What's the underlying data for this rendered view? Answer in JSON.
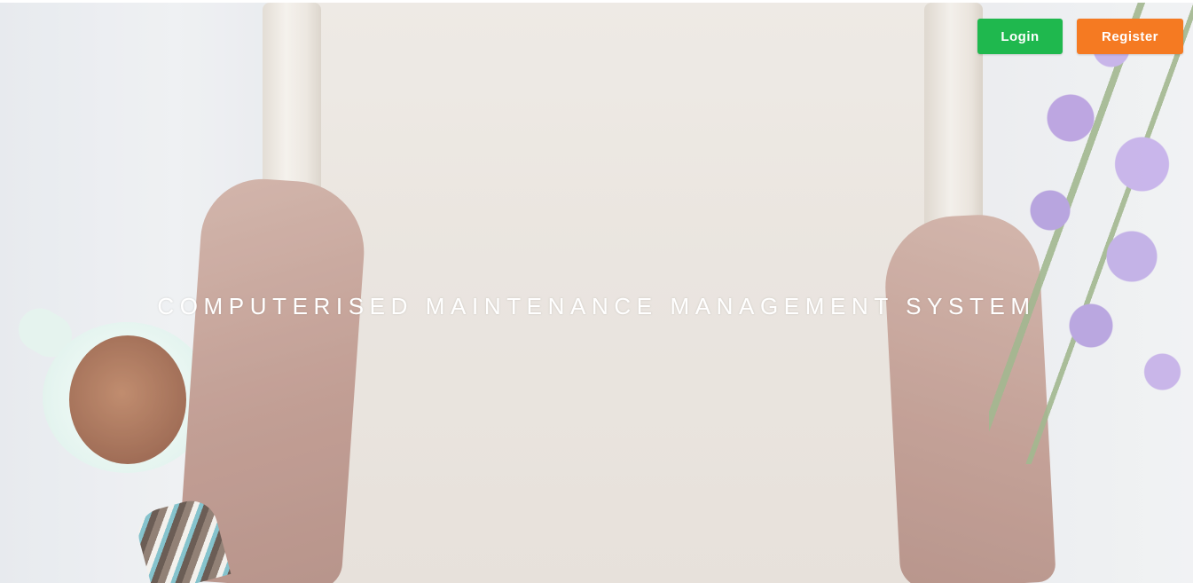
{
  "header": {
    "login_label": "Login",
    "register_label": "Register"
  },
  "hero": {
    "title": "COMPUTERISED MAINTENANCE MANAGEMENT SYSTEM"
  },
  "colors": {
    "login_button": "#1fb84e",
    "register_button": "#f57a22",
    "title_text": "#ffffff"
  },
  "icons": {
    "background": "hero-background-image"
  }
}
